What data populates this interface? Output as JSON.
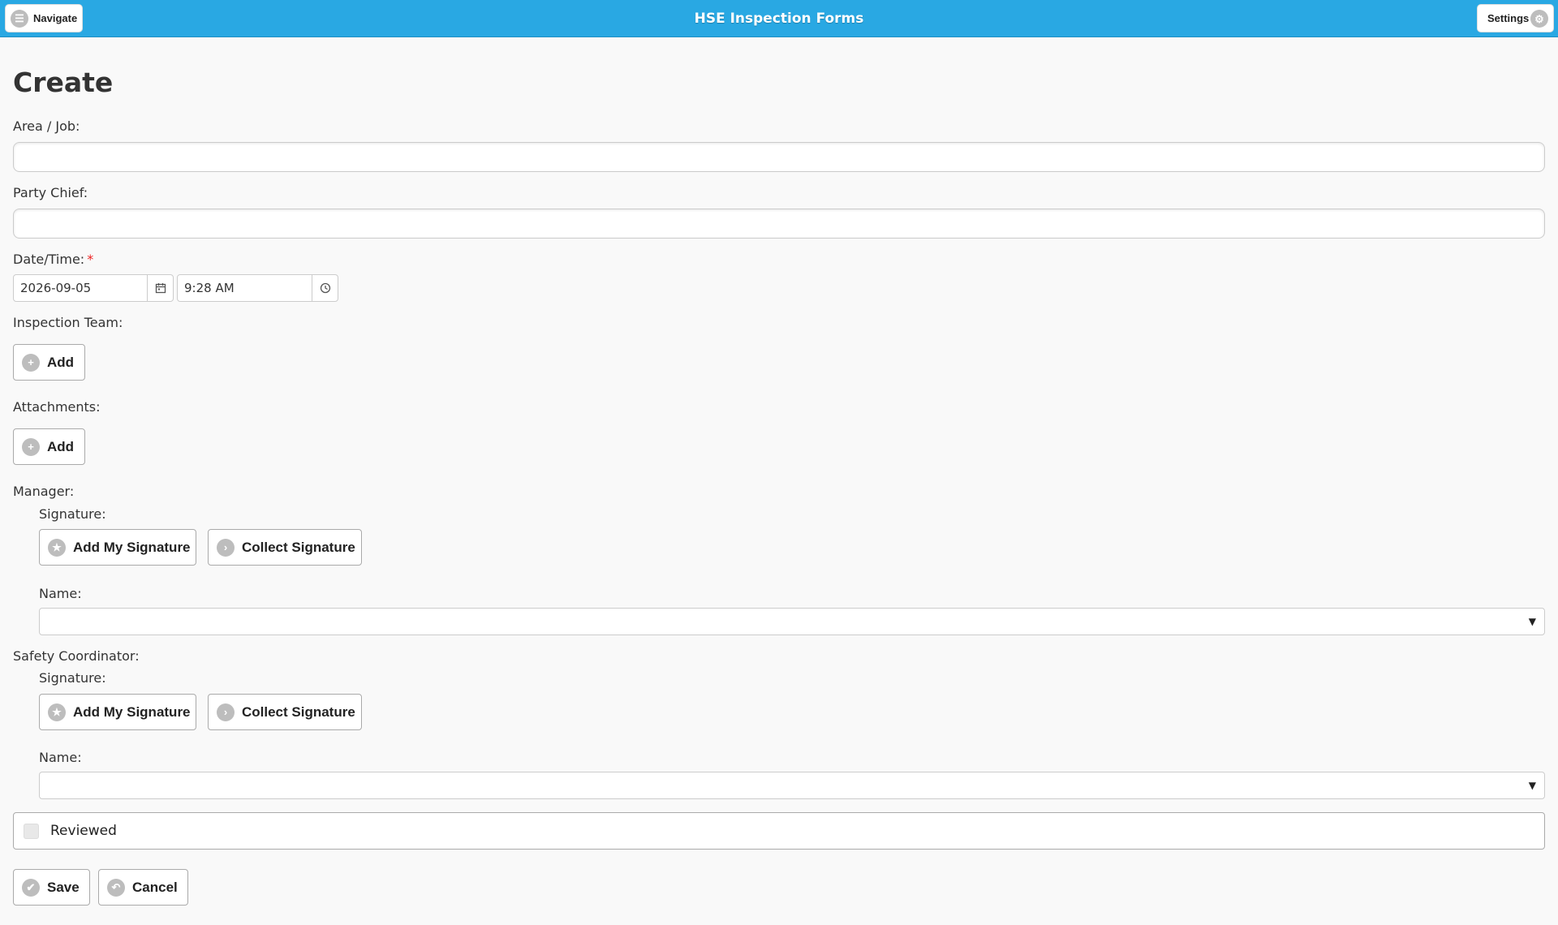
{
  "header": {
    "title": "HSE Inspection Forms",
    "navigate_label": "Navigate",
    "settings_label": "Settings"
  },
  "page": {
    "title": "Create"
  },
  "form": {
    "area_job_label": "Area / Job:",
    "area_job_value": "",
    "party_chief_label": "Party Chief:",
    "party_chief_value": "",
    "datetime_label": "Date/Time:",
    "required_marker": "*",
    "date_value": "2026-09-05",
    "time_value": "9:28 AM",
    "inspection_team_label": "Inspection Team:",
    "attachments_label": "Attachments:",
    "add_label": "Add",
    "manager": {
      "label": "Manager:",
      "signature_label": "Signature:",
      "add_my_signature": "Add My Signature",
      "collect_signature": "Collect Signature",
      "name_label": "Name:",
      "name_value": ""
    },
    "safety_coordinator": {
      "label": "Safety Coordinator:",
      "signature_label": "Signature:",
      "add_my_signature": "Add My Signature",
      "collect_signature": "Collect Signature",
      "name_label": "Name:",
      "name_value": ""
    },
    "reviewed_label": "Reviewed",
    "reviewed_checked": false
  },
  "actions": {
    "save_label": "Save",
    "cancel_label": "Cancel"
  },
  "icons": {
    "navigate": "menu-icon",
    "settings": "gear-icon",
    "calendar": "calendar-icon",
    "clock": "clock-icon",
    "add": "plus-icon",
    "star": "star-icon",
    "arrow": "arrow-right-icon",
    "check": "check-icon",
    "cancel": "back-icon"
  },
  "colors": {
    "header": "#29a8e3",
    "required": "#ee2222"
  }
}
